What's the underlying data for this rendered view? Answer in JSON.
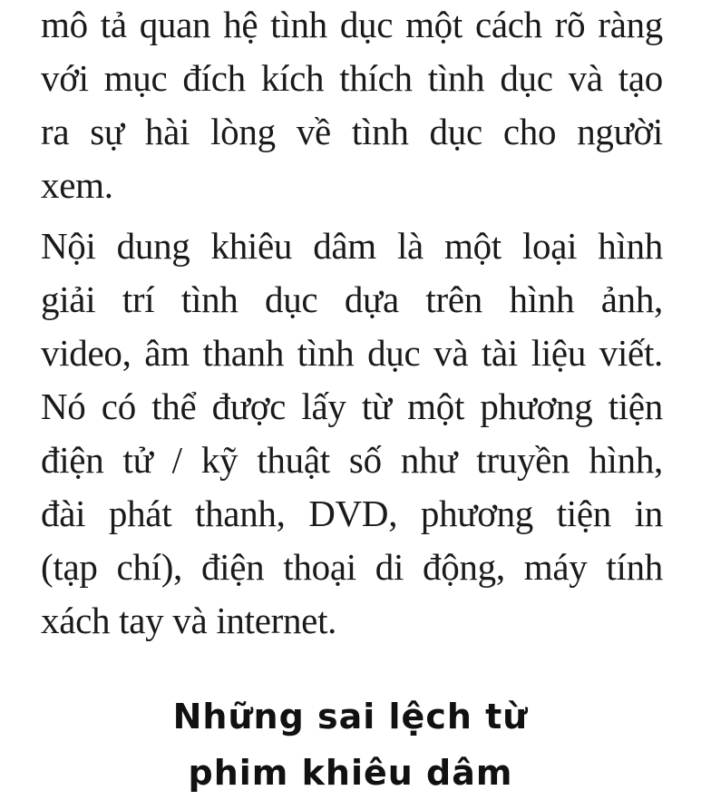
{
  "paragraph_1": {
    "lines": [
      "mô tả quan hệ tình dục một cách rõ ràng",
      "với mục đích kích thích tình dục và tạo",
      "ra sự hài lòng về tình dục cho người",
      "xem."
    ]
  },
  "paragraph_2": {
    "lines": [
      "Nội dung khiêu dâm là một loại hình",
      "giải trí tình dục dựa trên hình ảnh,",
      "video, âm thanh tình dục và tài liệu viết.",
      "Nó có thể được lấy từ một phương tiện",
      "điện tử / kỹ thuật số như truyền hình,",
      "đài phát thanh, DVD, phương tiện in",
      "(tạp chí), điện thoại di động, máy tính",
      "xách tay và internet."
    ]
  },
  "heading": {
    "line_1": "Những sai lệch từ",
    "line_2": "phim khiêu dâm"
  }
}
